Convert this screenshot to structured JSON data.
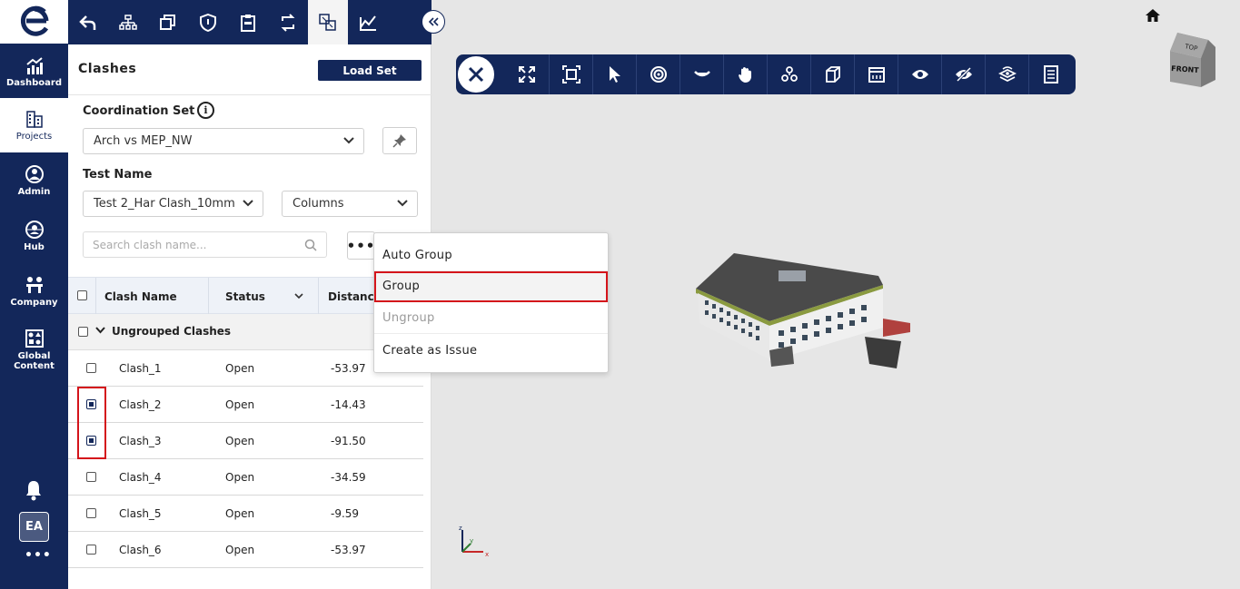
{
  "nav": {
    "items": [
      {
        "label": "Dashboard",
        "icon": "chart-icon"
      },
      {
        "label": "Projects",
        "icon": "building-icon"
      },
      {
        "label": "Admin",
        "icon": "user-gear-icon"
      },
      {
        "label": "Hub",
        "icon": "globe-user-icon"
      },
      {
        "label": "Company",
        "icon": "company-icon"
      },
      {
        "label": "Global Content",
        "icon": "shapes-icon"
      }
    ],
    "avatar": "EA",
    "more": "•••"
  },
  "panel": {
    "title": "Clashes",
    "load_set": "Load Set",
    "coordination_set_label": "Coordination Set",
    "coordination_set_value": "Arch vs MEP_NW",
    "test_name_label": "Test Name",
    "test_name_value": "Test 2_Har Clash_10mm",
    "columns_value": "Columns",
    "search_placeholder": "Search clash name...",
    "more_label": "•••",
    "table": {
      "headers": [
        "Clash Name",
        "Status",
        "Distance"
      ],
      "group_label": "Ungrouped Clashes",
      "rows": [
        {
          "name": "Clash_1",
          "status": "Open",
          "distance": "-53.97"
        },
        {
          "name": "Clash_2",
          "status": "Open",
          "distance": "-14.43"
        },
        {
          "name": "Clash_3",
          "status": "Open",
          "distance": "-91.50"
        },
        {
          "name": "Clash_4",
          "status": "Open",
          "distance": "-34.59"
        },
        {
          "name": "Clash_5",
          "status": "Open",
          "distance": "-9.59"
        },
        {
          "name": "Clash_6",
          "status": "Open",
          "distance": "-53.97"
        }
      ]
    }
  },
  "menu": {
    "items": [
      "Auto Group",
      "Group",
      "Ungroup",
      "Create as Issue"
    ]
  },
  "viewer": {
    "cube_top": "TOP",
    "cube_front": "FRONT",
    "axes": {
      "x": "x",
      "y": "y",
      "z": "z"
    }
  },
  "colors": {
    "navy": "#13275a",
    "highlight": "#d4141b"
  }
}
